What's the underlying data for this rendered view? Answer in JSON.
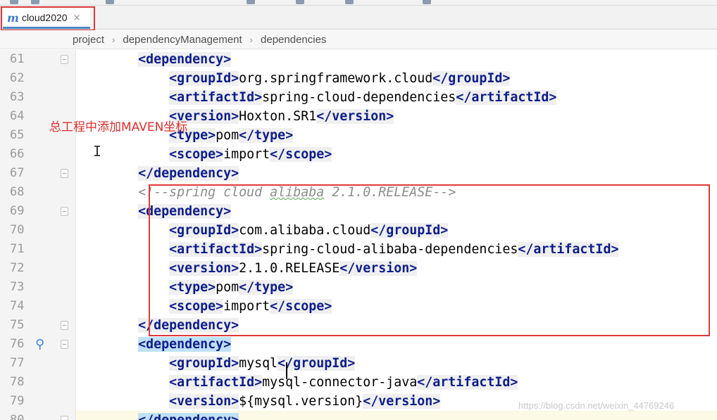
{
  "tab": {
    "icon": "maven-m-icon",
    "icon_glyph": "m",
    "label": "cloud2020",
    "close_glyph": "×"
  },
  "breadcrumb": [
    "project",
    "dependencyManagement",
    "dependencies"
  ],
  "annotation": "总工程中添加MAVEN坐标",
  "watermark": "https://blog.csdn.net/weixin_44769246",
  "colors": {
    "tag": "#0d1d8c",
    "comment": "#8c8c8c",
    "highlight_box": "#e03a3a",
    "tag_highlight": "#bfe0f7"
  },
  "code": [
    {
      "n": "61",
      "indent": "        ",
      "parts": [
        [
          "tag",
          "<dependency>"
        ]
      ]
    },
    {
      "n": "62",
      "indent": "            ",
      "parts": [
        [
          "tag",
          "<groupId>"
        ],
        [
          "txt",
          "org.springframework.cloud"
        ],
        [
          "tag",
          "</groupId>"
        ]
      ]
    },
    {
      "n": "63",
      "indent": "            ",
      "parts": [
        [
          "tag",
          "<artifactId>"
        ],
        [
          "txt",
          "spring-cloud-dependencies"
        ],
        [
          "tag",
          "</artifactId>"
        ]
      ]
    },
    {
      "n": "64",
      "indent": "            ",
      "parts": [
        [
          "tag",
          "<version>"
        ],
        [
          "txt",
          "Hoxton.SR1"
        ],
        [
          "tag",
          "</version>"
        ]
      ]
    },
    {
      "n": "65",
      "indent": "            ",
      "parts": [
        [
          "tag",
          "<type>"
        ],
        [
          "txt",
          "pom"
        ],
        [
          "tag",
          "</type>"
        ]
      ]
    },
    {
      "n": "66",
      "indent": "            ",
      "parts": [
        [
          "tag",
          "<scope>"
        ],
        [
          "txt",
          "import"
        ],
        [
          "tag",
          "</scope>"
        ]
      ]
    },
    {
      "n": "67",
      "indent": "        ",
      "parts": [
        [
          "tag",
          "</dependency>"
        ]
      ]
    },
    {
      "n": "68",
      "indent": "        ",
      "parts": [
        [
          "cmt",
          "<!--spring cloud "
        ],
        [
          "cmt squig",
          "alibaba"
        ],
        [
          "cmt",
          " 2.1.0.RELEASE-->"
        ]
      ]
    },
    {
      "n": "69",
      "indent": "        ",
      "parts": [
        [
          "tag",
          "<dependency>"
        ]
      ]
    },
    {
      "n": "70",
      "indent": "            ",
      "parts": [
        [
          "tag",
          "<groupId>"
        ],
        [
          "txt",
          "com.alibaba.cloud"
        ],
        [
          "tag",
          "</groupId>"
        ]
      ]
    },
    {
      "n": "71",
      "indent": "            ",
      "parts": [
        [
          "tag",
          "<artifactId>"
        ],
        [
          "txt",
          "spring-cloud-alibaba-dependencies"
        ],
        [
          "tag",
          "</artifactId>"
        ]
      ]
    },
    {
      "n": "72",
      "indent": "            ",
      "parts": [
        [
          "tag",
          "<version>"
        ],
        [
          "txt",
          "2.1.0.RELEASE"
        ],
        [
          "tag",
          "</version>"
        ]
      ]
    },
    {
      "n": "73",
      "indent": "            ",
      "parts": [
        [
          "tag",
          "<type>"
        ],
        [
          "txt",
          "pom"
        ],
        [
          "tag",
          "</type>"
        ]
      ]
    },
    {
      "n": "74",
      "indent": "            ",
      "parts": [
        [
          "tag",
          "<scope>"
        ],
        [
          "txt",
          "import"
        ],
        [
          "tag",
          "</scope>"
        ]
      ]
    },
    {
      "n": "75",
      "indent": "        ",
      "parts": [
        [
          "tag",
          "</dependency>"
        ]
      ]
    },
    {
      "n": "76",
      "indent": "        ",
      "parts": [
        [
          "tag tag-hl",
          "<dependency>"
        ]
      ]
    },
    {
      "n": "77",
      "indent": "            ",
      "parts": [
        [
          "tag",
          "<groupId>"
        ],
        [
          "txt",
          "mysql"
        ],
        [
          "tag",
          "</groupId>"
        ]
      ]
    },
    {
      "n": "78",
      "indent": "            ",
      "parts": [
        [
          "tag",
          "<artifactId>"
        ],
        [
          "txt",
          "mysql-connector-java"
        ],
        [
          "tag",
          "</artifactId>"
        ]
      ]
    },
    {
      "n": "79",
      "indent": "            ",
      "parts": [
        [
          "tag",
          "<version>"
        ],
        [
          "txt",
          "${mysql.version}"
        ],
        [
          "tag",
          "</version>"
        ]
      ]
    },
    {
      "n": "80",
      "indent": "        ",
      "parts": [
        [
          "tag tag-hl",
          "</dependency>"
        ]
      ]
    }
  ]
}
